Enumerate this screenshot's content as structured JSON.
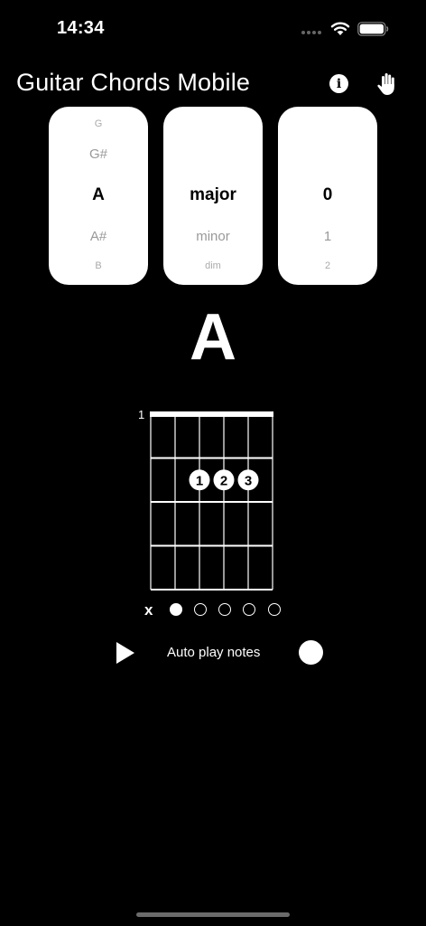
{
  "status_bar": {
    "time": "14:34"
  },
  "header": {
    "title": "Guitar Chords Mobile",
    "info_icon": "info-icon",
    "hand_icon": "hand-icon"
  },
  "pickers": {
    "root": {
      "items": [
        "G",
        "G#",
        "A",
        "A#",
        "B"
      ]
    },
    "quality": {
      "items": [
        "",
        "",
        "major",
        "minor",
        "dim"
      ]
    },
    "variant": {
      "items": [
        "",
        "",
        "0",
        "1",
        "2"
      ]
    }
  },
  "chord": {
    "name": "A",
    "fret_start": "1",
    "fingers": [
      {
        "label": "1",
        "string": 3,
        "fret": 2
      },
      {
        "label": "2",
        "string": 4,
        "fret": 2
      },
      {
        "label": "3",
        "string": 5,
        "fret": 2
      }
    ],
    "strings_state": [
      "x",
      "played",
      "open",
      "open",
      "open",
      "open"
    ],
    "mute_label": "x"
  },
  "controls": {
    "auto_play_label": "Auto play notes",
    "auto_play_enabled": false
  }
}
